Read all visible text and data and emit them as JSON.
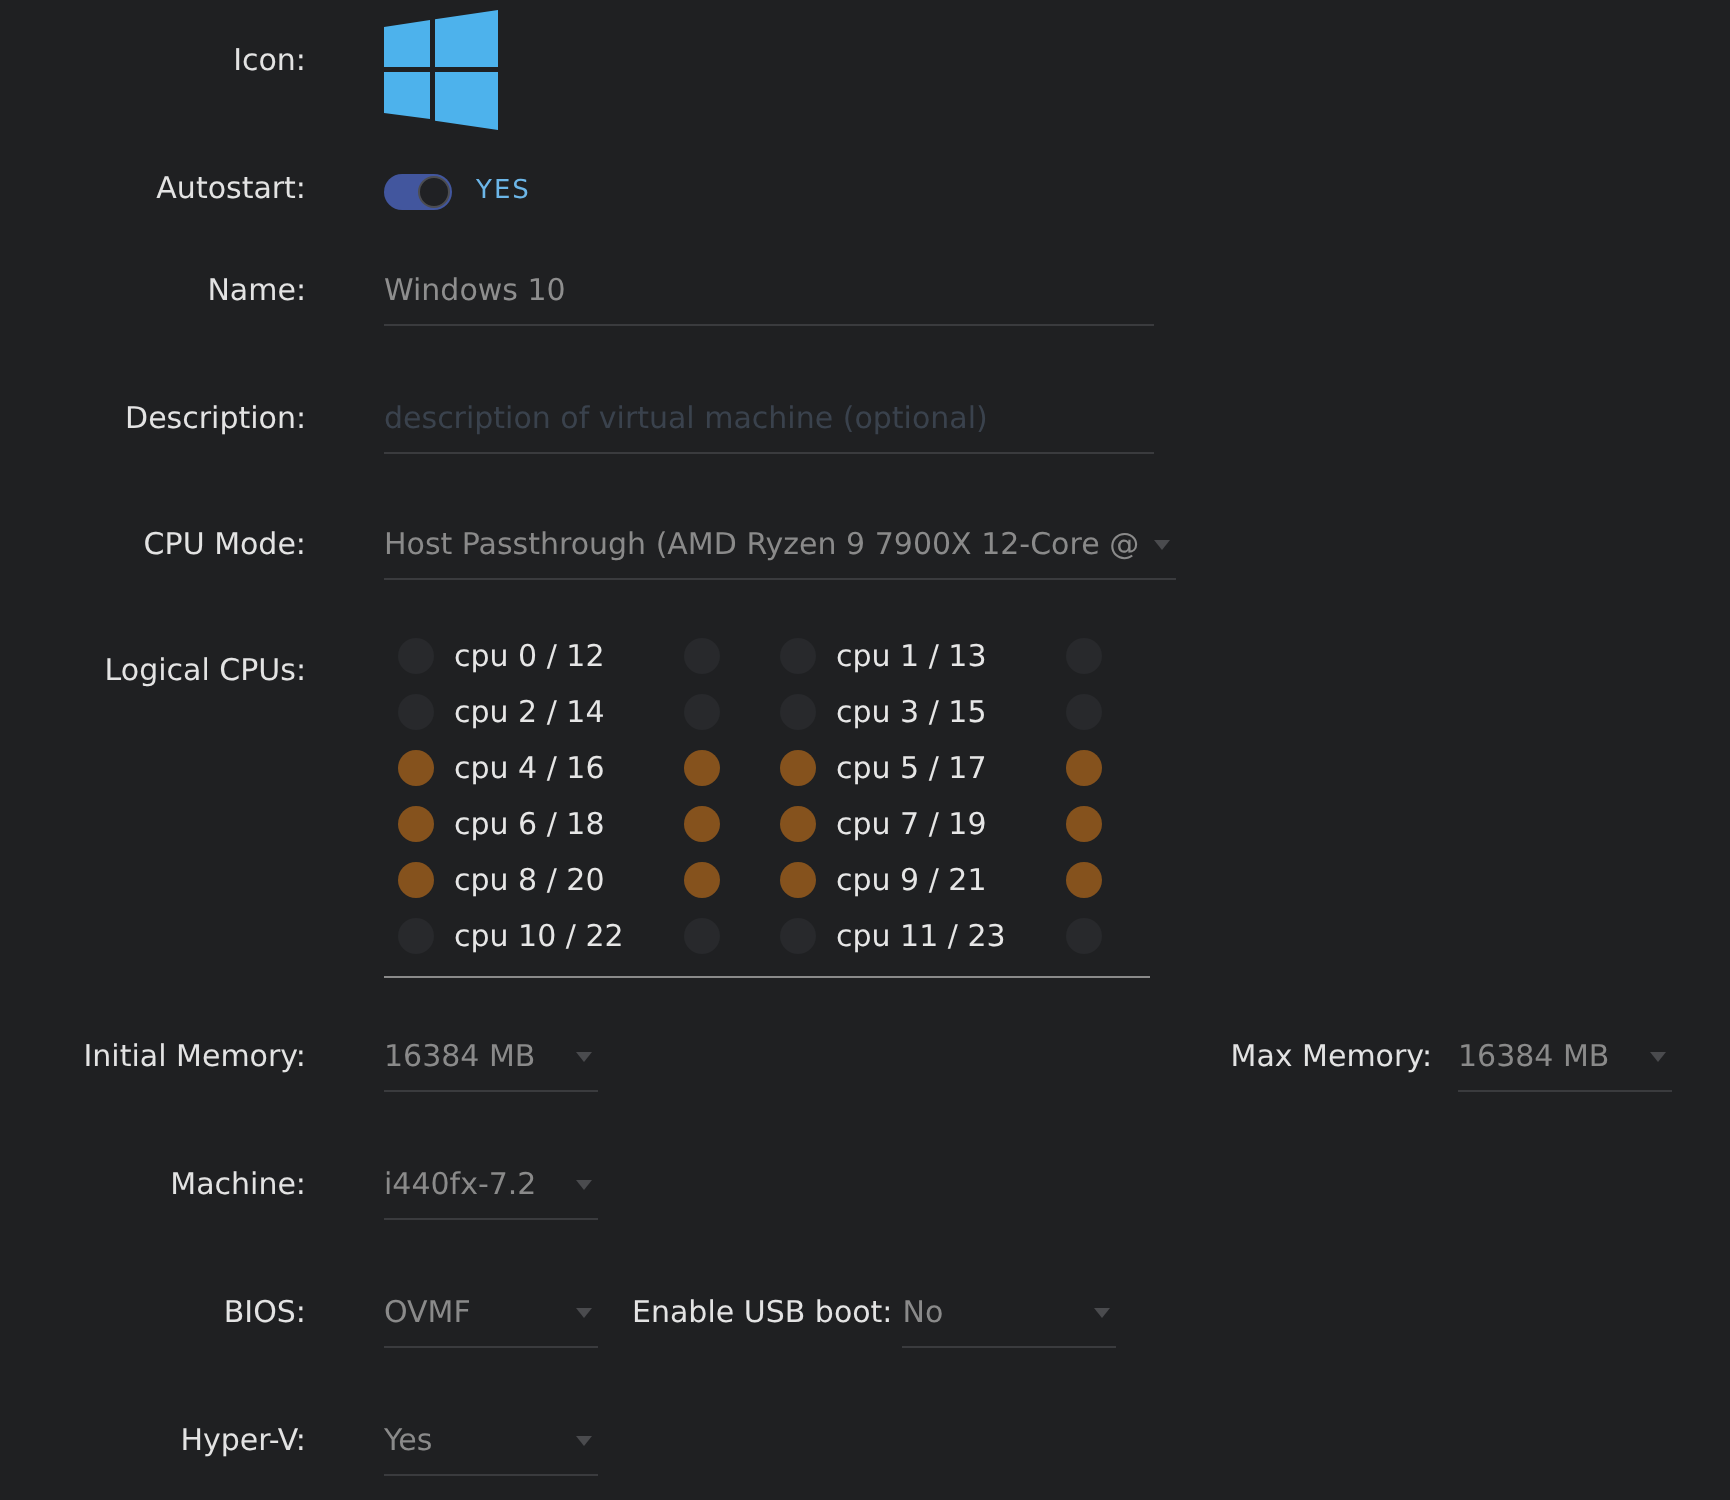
{
  "icon": {
    "label": "Icon:"
  },
  "autostart": {
    "label": "Autostart:",
    "on": true,
    "state_text": "YES"
  },
  "name": {
    "label": "Name:",
    "value": "Windows 10"
  },
  "description": {
    "label": "Description:",
    "placeholder": "description of virtual machine (optional)"
  },
  "cpu_mode": {
    "label": "CPU Mode:",
    "value": "Host Passthrough (AMD Ryzen 9 7900X 12-Core @"
  },
  "logical_cpus": {
    "label": "Logical CPUs:",
    "cpus": [
      {
        "label": "cpu 0 / 12",
        "checked": false,
        "sibling_checked": false
      },
      {
        "label": "cpu 1 / 13",
        "checked": false,
        "sibling_checked": false
      },
      {
        "label": "cpu 2 / 14",
        "checked": false,
        "sibling_checked": false
      },
      {
        "label": "cpu 3 / 15",
        "checked": false,
        "sibling_checked": false
      },
      {
        "label": "cpu 4 / 16",
        "checked": true,
        "sibling_checked": true
      },
      {
        "label": "cpu 5 / 17",
        "checked": true,
        "sibling_checked": true
      },
      {
        "label": "cpu 6 / 18",
        "checked": true,
        "sibling_checked": true
      },
      {
        "label": "cpu 7 / 19",
        "checked": true,
        "sibling_checked": true
      },
      {
        "label": "cpu 8 / 20",
        "checked": true,
        "sibling_checked": true
      },
      {
        "label": "cpu 9 / 21",
        "checked": true,
        "sibling_checked": true
      },
      {
        "label": "cpu 10 / 22",
        "checked": false,
        "sibling_checked": false
      },
      {
        "label": "cpu 11 / 23",
        "checked": false,
        "sibling_checked": false
      }
    ]
  },
  "initial_memory": {
    "label": "Initial Memory:",
    "value": "16384 MB"
  },
  "max_memory": {
    "label": "Max Memory:",
    "value": "16384 MB"
  },
  "machine": {
    "label": "Machine:",
    "value": "i440fx-7.2"
  },
  "bios": {
    "label": "BIOS:",
    "value": "OVMF"
  },
  "usb_boot": {
    "label": "Enable USB boot:",
    "value": "No"
  },
  "hyper_v": {
    "label": "Hyper-V:",
    "value": "Yes"
  }
}
